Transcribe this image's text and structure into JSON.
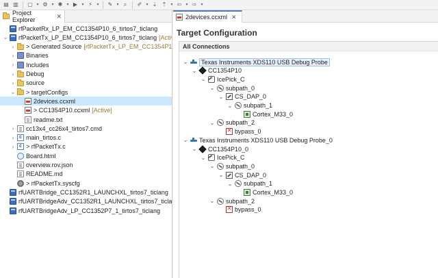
{
  "toolbar": {
    "icons": [
      "save-icon",
      "save-all-icon",
      "new-icon",
      "build-icon",
      "debug-icon",
      "run-icon",
      "flash-icon",
      "wrench-icon",
      "search-icon",
      "pin-icon",
      "next-annotation-icon",
      "prev-annotation-icon",
      "back-icon",
      "forward-icon"
    ]
  },
  "project_explorer": {
    "tab_title": "Project Explorer",
    "rows": [
      {
        "label": "rfPacketRx_LP_EM_CC1354P10_6_tirtos7_ticlang",
        "decoration": "",
        "depth": 0,
        "twisty": "",
        "icon": "project"
      },
      {
        "label": "rfPacketTx_LP_EM_CC1354P10_6_tirtos7_ticlang",
        "decoration": "[Active - D",
        "depth": 0,
        "twisty": "v",
        "icon": "project"
      },
      {
        "label": "> Generated Source",
        "decoration": "[rfPacketTx_LP_EM_CC1354P10_6_tirto",
        "depth": 1,
        "twisty": ">",
        "icon": "folder"
      },
      {
        "label": "Binaries",
        "decoration": "",
        "depth": 1,
        "twisty": ">",
        "icon": "pkg"
      },
      {
        "label": "Includes",
        "decoration": "",
        "depth": 1,
        "twisty": ">",
        "icon": "pkg"
      },
      {
        "label": "Debug",
        "decoration": "",
        "depth": 1,
        "twisty": ">",
        "icon": "folder"
      },
      {
        "label": "source",
        "decoration": "",
        "depth": 1,
        "twisty": ">",
        "icon": "folder"
      },
      {
        "label": "> targetConfigs",
        "decoration": "",
        "depth": 1,
        "twisty": "v",
        "icon": "folder"
      },
      {
        "label": "2devices.ccxml",
        "decoration": "",
        "depth": 2,
        "twisty": "",
        "icon": "ccxml",
        "selected": true
      },
      {
        "label": "> CC1354P10.ccxml",
        "decoration": "[Active]",
        "depth": 2,
        "twisty": "",
        "icon": "ccxml"
      },
      {
        "label": "readme.txt",
        "decoration": "",
        "depth": 2,
        "twisty": "",
        "icon": "file"
      },
      {
        "label": "cc13x4_cc26x4_tirtos7.cmd",
        "decoration": "",
        "depth": 1,
        "twisty": ">",
        "icon": "file"
      },
      {
        "label": "main_tirtos.c",
        "decoration": "",
        "depth": 1,
        "twisty": ">",
        "icon": "cfile"
      },
      {
        "label": "> rfPacketTx.c",
        "decoration": "",
        "depth": 1,
        "twisty": ">",
        "icon": "cfile"
      },
      {
        "label": "Board.html",
        "decoration": "",
        "depth": 1,
        "twisty": "",
        "icon": "html"
      },
      {
        "label": "overview.rov.json",
        "decoration": "",
        "depth": 1,
        "twisty": "",
        "icon": "file"
      },
      {
        "label": "README.md",
        "decoration": "",
        "depth": 1,
        "twisty": "",
        "icon": "file"
      },
      {
        "label": "> rfPacketTx.syscfg",
        "decoration": "",
        "depth": 1,
        "twisty": "",
        "icon": "gear"
      },
      {
        "label": "rfUARTBridge_CC1352R1_LAUNCHXL_tirtos7_ticlang",
        "decoration": "",
        "depth": 0,
        "twisty": "",
        "icon": "project"
      },
      {
        "label": "rfUARTBridgeAdv_CC1352R1_LAUNCHXL_tirtos7_ticlang",
        "decoration": "",
        "depth": 0,
        "twisty": "",
        "icon": "project"
      },
      {
        "label": "rfUARTBridgeAdv_LP_CC1352P7_1_tirtos7_ticlang",
        "decoration": "",
        "depth": 0,
        "twisty": "",
        "icon": "project"
      }
    ]
  },
  "editor": {
    "tab_title": "2devices.ccxml",
    "page_title": "Target Configuration",
    "section_title": "All Connections",
    "nodes": [
      {
        "label": "Texas Instruments XDS110 USB Debug Probe",
        "depth": 0,
        "twisty": "v",
        "icon": "probe",
        "selected": true
      },
      {
        "label": "CC1354P10",
        "depth": 1,
        "twisty": "v",
        "icon": "chip"
      },
      {
        "label": "IcePick_C",
        "depth": 2,
        "twisty": "v",
        "icon": "icepick"
      },
      {
        "label": "subpath_0",
        "depth": 3,
        "twisty": "v",
        "icon": "subpath"
      },
      {
        "label": "CS_DAP_0",
        "depth": 4,
        "twisty": "v",
        "icon": "dap"
      },
      {
        "label": "subpath_1",
        "depth": 5,
        "twisty": "v",
        "icon": "subpath"
      },
      {
        "label": "Cortex_M33_0",
        "depth": 6,
        "twisty": "",
        "icon": "cpu"
      },
      {
        "label": "subpath_2",
        "depth": 3,
        "twisty": "v",
        "icon": "subpath"
      },
      {
        "label": "bypass_0",
        "depth": 4,
        "twisty": "",
        "icon": "bypass"
      },
      {
        "label": "Texas Instruments XDS110 USB Debug Probe_0",
        "depth": 0,
        "twisty": "v",
        "icon": "probe"
      },
      {
        "label": "CC1354P10_0",
        "depth": 1,
        "twisty": "v",
        "icon": "chip"
      },
      {
        "label": "IcePick_C",
        "depth": 2,
        "twisty": "v",
        "icon": "icepick"
      },
      {
        "label": "subpath_0",
        "depth": 3,
        "twisty": "v",
        "icon": "subpath"
      },
      {
        "label": "CS_DAP_0",
        "depth": 4,
        "twisty": "v",
        "icon": "dap"
      },
      {
        "label": "subpath_1",
        "depth": 5,
        "twisty": "v",
        "icon": "subpath"
      },
      {
        "label": "Cortex_M33_0",
        "depth": 6,
        "twisty": "",
        "icon": "cpu"
      },
      {
        "label": "subpath_2",
        "depth": 3,
        "twisty": "v",
        "icon": "subpath"
      },
      {
        "label": "bypass_0",
        "depth": 4,
        "twisty": "",
        "icon": "bypass"
      }
    ]
  }
}
